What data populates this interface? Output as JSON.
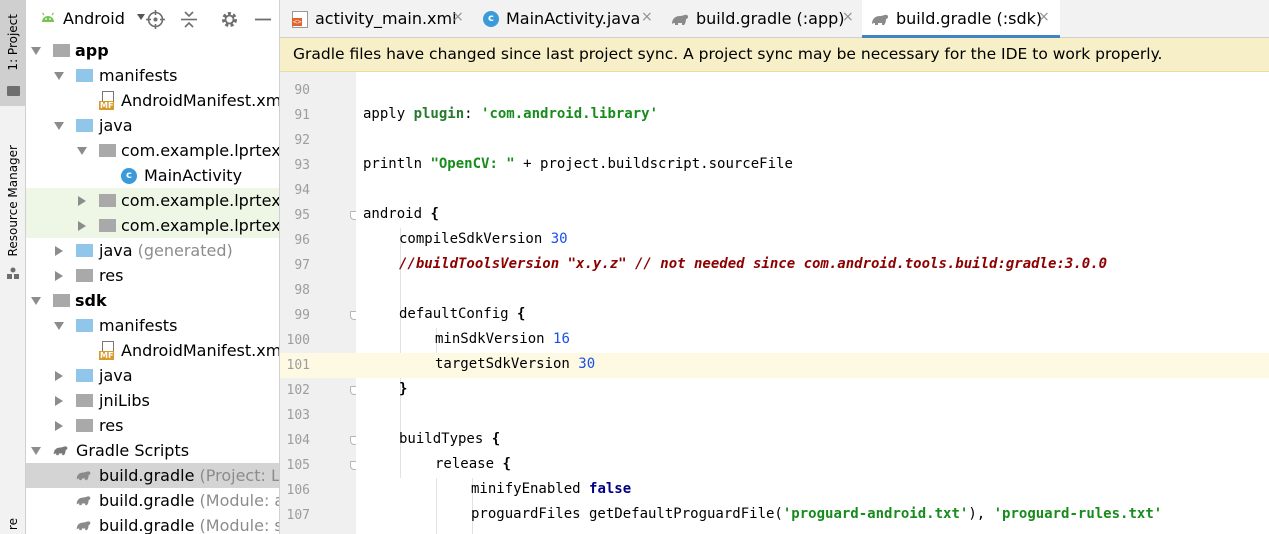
{
  "sidebar_strip": {
    "project_tab": "1: Project",
    "resource_tab": "Resource Manager",
    "bottom_tab": "re"
  },
  "project_panel": {
    "view_mode": "Android",
    "tree": [
      {
        "label": "app",
        "bold": true,
        "icon": "module-folder-icon",
        "expanded": true
      },
      {
        "label": "manifests",
        "icon": "folder-icon",
        "expanded": true
      },
      {
        "label": "AndroidManifest.xml",
        "icon": "manifest-file-icon"
      },
      {
        "label": "java",
        "icon": "folder-icon",
        "expanded": true
      },
      {
        "label": "com.example.lprtext",
        "icon": "package-icon",
        "expanded": true
      },
      {
        "label": "MainActivity",
        "icon": "class-icon"
      },
      {
        "label": "com.example.lprtext",
        "icon": "package-icon",
        "expanded": false
      },
      {
        "label": "com.example.lprtext",
        "icon": "package-icon",
        "expanded": false
      },
      {
        "label": "java",
        "sub": "(generated)",
        "icon": "generated-folder-icon",
        "expanded": false
      },
      {
        "label": "res",
        "icon": "res-folder-icon",
        "expanded": false
      },
      {
        "label": "sdk",
        "bold": true,
        "icon": "module-folder-icon",
        "expanded": true
      },
      {
        "label": "manifests",
        "icon": "folder-icon",
        "expanded": true
      },
      {
        "label": "AndroidManifest.xml",
        "icon": "manifest-file-icon"
      },
      {
        "label": "java",
        "icon": "folder-icon",
        "expanded": false
      },
      {
        "label": "jniLibs",
        "icon": "folder-icon",
        "expanded": false
      },
      {
        "label": "res",
        "icon": "res-folder-icon",
        "expanded": false
      },
      {
        "label": "Gradle Scripts",
        "icon": "gradle-icon",
        "expanded": true
      },
      {
        "label": "build.gradle",
        "sub": "(Project: LP",
        "icon": "gradle-file-icon"
      },
      {
        "label": "build.gradle",
        "sub": "(Module: ap",
        "icon": "gradle-file-icon"
      },
      {
        "label": "build.gradle",
        "sub": "(Module: sd",
        "icon": "gradle-file-icon"
      }
    ]
  },
  "tabs": [
    {
      "label": "activity_main.xml",
      "icon": "xml-file-icon",
      "close": "×"
    },
    {
      "label": "MainActivity.java",
      "icon": "class-icon",
      "close": "×"
    },
    {
      "label": "build.gradle (:app)",
      "icon": "gradle-file-icon",
      "close": "×"
    },
    {
      "label": "build.gradle (:sdk)",
      "icon": "gradle-file-icon",
      "close": "×",
      "active": true
    }
  ],
  "banner": {
    "message": "Gradle files have changed since last project sync. A project sync may be necessary for the IDE to work properly."
  },
  "editor": {
    "current_line": "101",
    "line_numbers": [
      "90",
      "91",
      "92",
      "93",
      "94",
      "95",
      "96",
      "97",
      "98",
      "99",
      "100",
      "101",
      "102",
      "103",
      "104",
      "105",
      "106",
      "107"
    ],
    "tokens": {
      "apply": "apply ",
      "plugin": "plugin",
      "colon": ": ",
      "plugin_id": "'com.android.library'",
      "println": "println ",
      "opencv_str": "\"OpenCV: \"",
      "concat": " + project.buildscript.sourceFile",
      "android": "android ",
      "brace_open": "{",
      "brace_close": "}",
      "compileSdk": "compileSdkVersion ",
      "v30": "30",
      "comment": "//buildToolsVersion \"x.y.z\" // not needed since com.android.tools.build:gradle:3.0.0",
      "defaultConfig": "defaultConfig ",
      "minSdk": "minSdkVersion ",
      "v16": "16",
      "targetSdk": "targetSdkVersion ",
      "buildTypes": "buildTypes ",
      "release": "release ",
      "minify": "minifyEnabled ",
      "false": "false",
      "proguard": "proguardFiles getDefaultProguardFile(",
      "pg_android": "'proguard-android.txt'",
      "comma": "), ",
      "pg_rules": "'proguard-rules.txt'"
    }
  }
}
